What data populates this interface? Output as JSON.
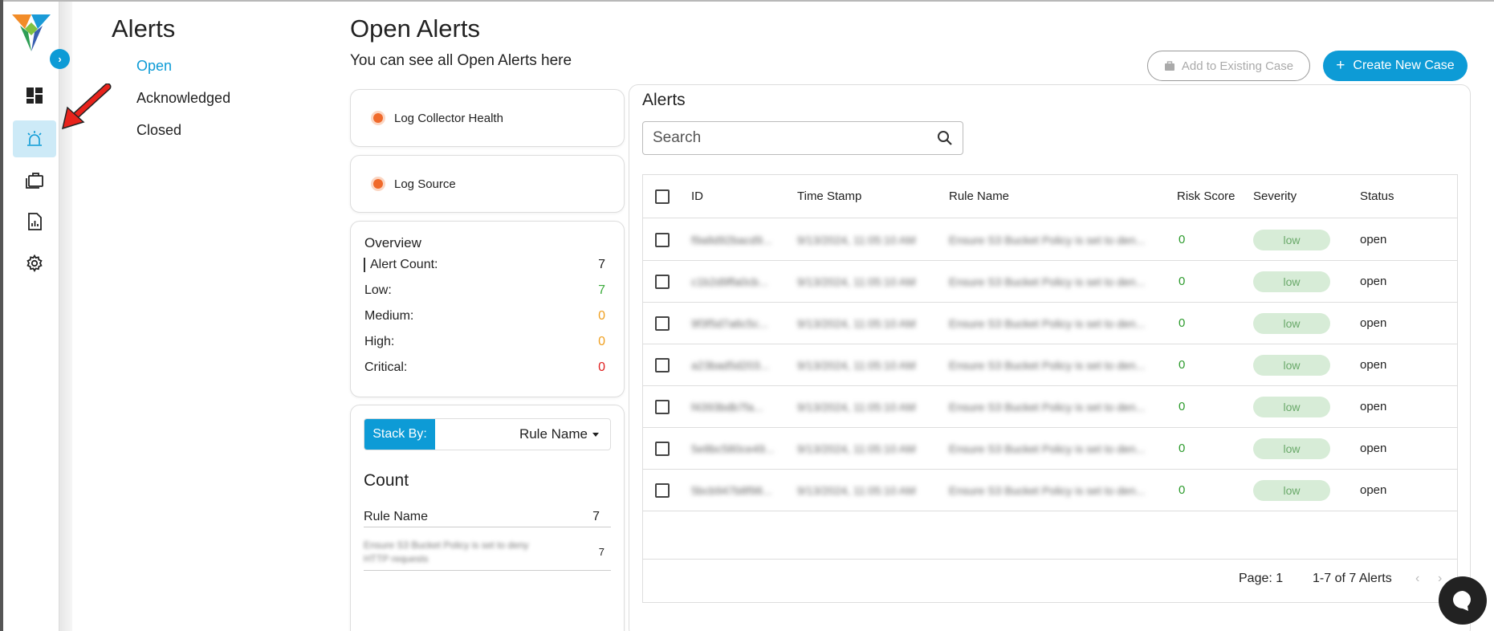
{
  "nav": {
    "title": "Alerts",
    "items": [
      {
        "label": "Open",
        "active": true
      },
      {
        "label": "Acknowledged",
        "active": false
      },
      {
        "label": "Closed",
        "active": false
      }
    ]
  },
  "rail": {
    "icons": [
      "dashboard-icon",
      "alarm-icon",
      "briefcase-icon",
      "report-icon",
      "gear-icon"
    ],
    "active": "alarm-icon"
  },
  "header": {
    "title": "Open Alerts",
    "subtitle": "You can see all Open Alerts here",
    "add_existing_label": "Add to Existing Case",
    "create_new_label": "Create New Case"
  },
  "sources": [
    {
      "label": "Log Collector Health"
    },
    {
      "label": "Log Source"
    }
  ],
  "overview": {
    "title": "Overview",
    "rows": [
      {
        "label": "Alert Count:",
        "value": "7",
        "color": "#222222"
      },
      {
        "label": "Low:",
        "value": "7",
        "color": "#3cab3c"
      },
      {
        "label": "Medium:",
        "value": "0",
        "color": "#f0a020"
      },
      {
        "label": "High:",
        "value": "0",
        "color": "#f0a020"
      },
      {
        "label": "Critical:",
        "value": "0",
        "color": "#e02020"
      }
    ]
  },
  "stack": {
    "label": "Stack By:",
    "selected": "Rule Name",
    "count_title": "Count",
    "head_label": "Rule Name",
    "head_value": "7",
    "rows": [
      {
        "label": "Ensure S3 Bucket Policy is set to deny HTTP requests",
        "value": "7"
      }
    ]
  },
  "alerts": {
    "title": "Alerts",
    "search_placeholder": "Search",
    "columns": [
      "ID",
      "Time Stamp",
      "Rule Name",
      "Risk Score",
      "Severity",
      "Status"
    ],
    "rows": [
      {
        "id": "f9a8d92bacd9...",
        "ts": "9/13/2024, 11:05:10 AM",
        "rule": "Ensure S3 Bucket Policy is set to den...",
        "risk": "0",
        "severity": "low",
        "status": "open"
      },
      {
        "id": "c1b2d9ffa0cb...",
        "ts": "9/13/2024, 11:05:10 AM",
        "rule": "Ensure S3 Bucket Policy is set to den...",
        "risk": "0",
        "severity": "low",
        "status": "open"
      },
      {
        "id": "9f3f5d7a6c5c...",
        "ts": "9/13/2024, 11:05:10 AM",
        "rule": "Ensure S3 Bucket Policy is set to den...",
        "risk": "0",
        "severity": "low",
        "status": "open"
      },
      {
        "id": "a23bad5d203...",
        "ts": "9/13/2024, 11:05:10 AM",
        "rule": "Ensure S3 Bucket Policy is set to den...",
        "risk": "0",
        "severity": "low",
        "status": "open"
      },
      {
        "id": "f4393bdb7fa...",
        "ts": "9/13/2024, 11:05:10 AM",
        "rule": "Ensure S3 Bucket Policy is set to den...",
        "risk": "0",
        "severity": "low",
        "status": "open"
      },
      {
        "id": "5e8bc580ce49...",
        "ts": "9/13/2024, 11:05:10 AM",
        "rule": "Ensure S3 Bucket Policy is set to den...",
        "risk": "0",
        "severity": "low",
        "status": "open"
      },
      {
        "id": "5bcb947b8f98...",
        "ts": "9/13/2024, 11:05:10 AM",
        "rule": "Ensure S3 Bucket Policy is set to den...",
        "risk": "0",
        "severity": "low",
        "status": "open"
      }
    ],
    "page_label": "Page: 1",
    "range_label": "1-7 of 7 Alerts"
  }
}
